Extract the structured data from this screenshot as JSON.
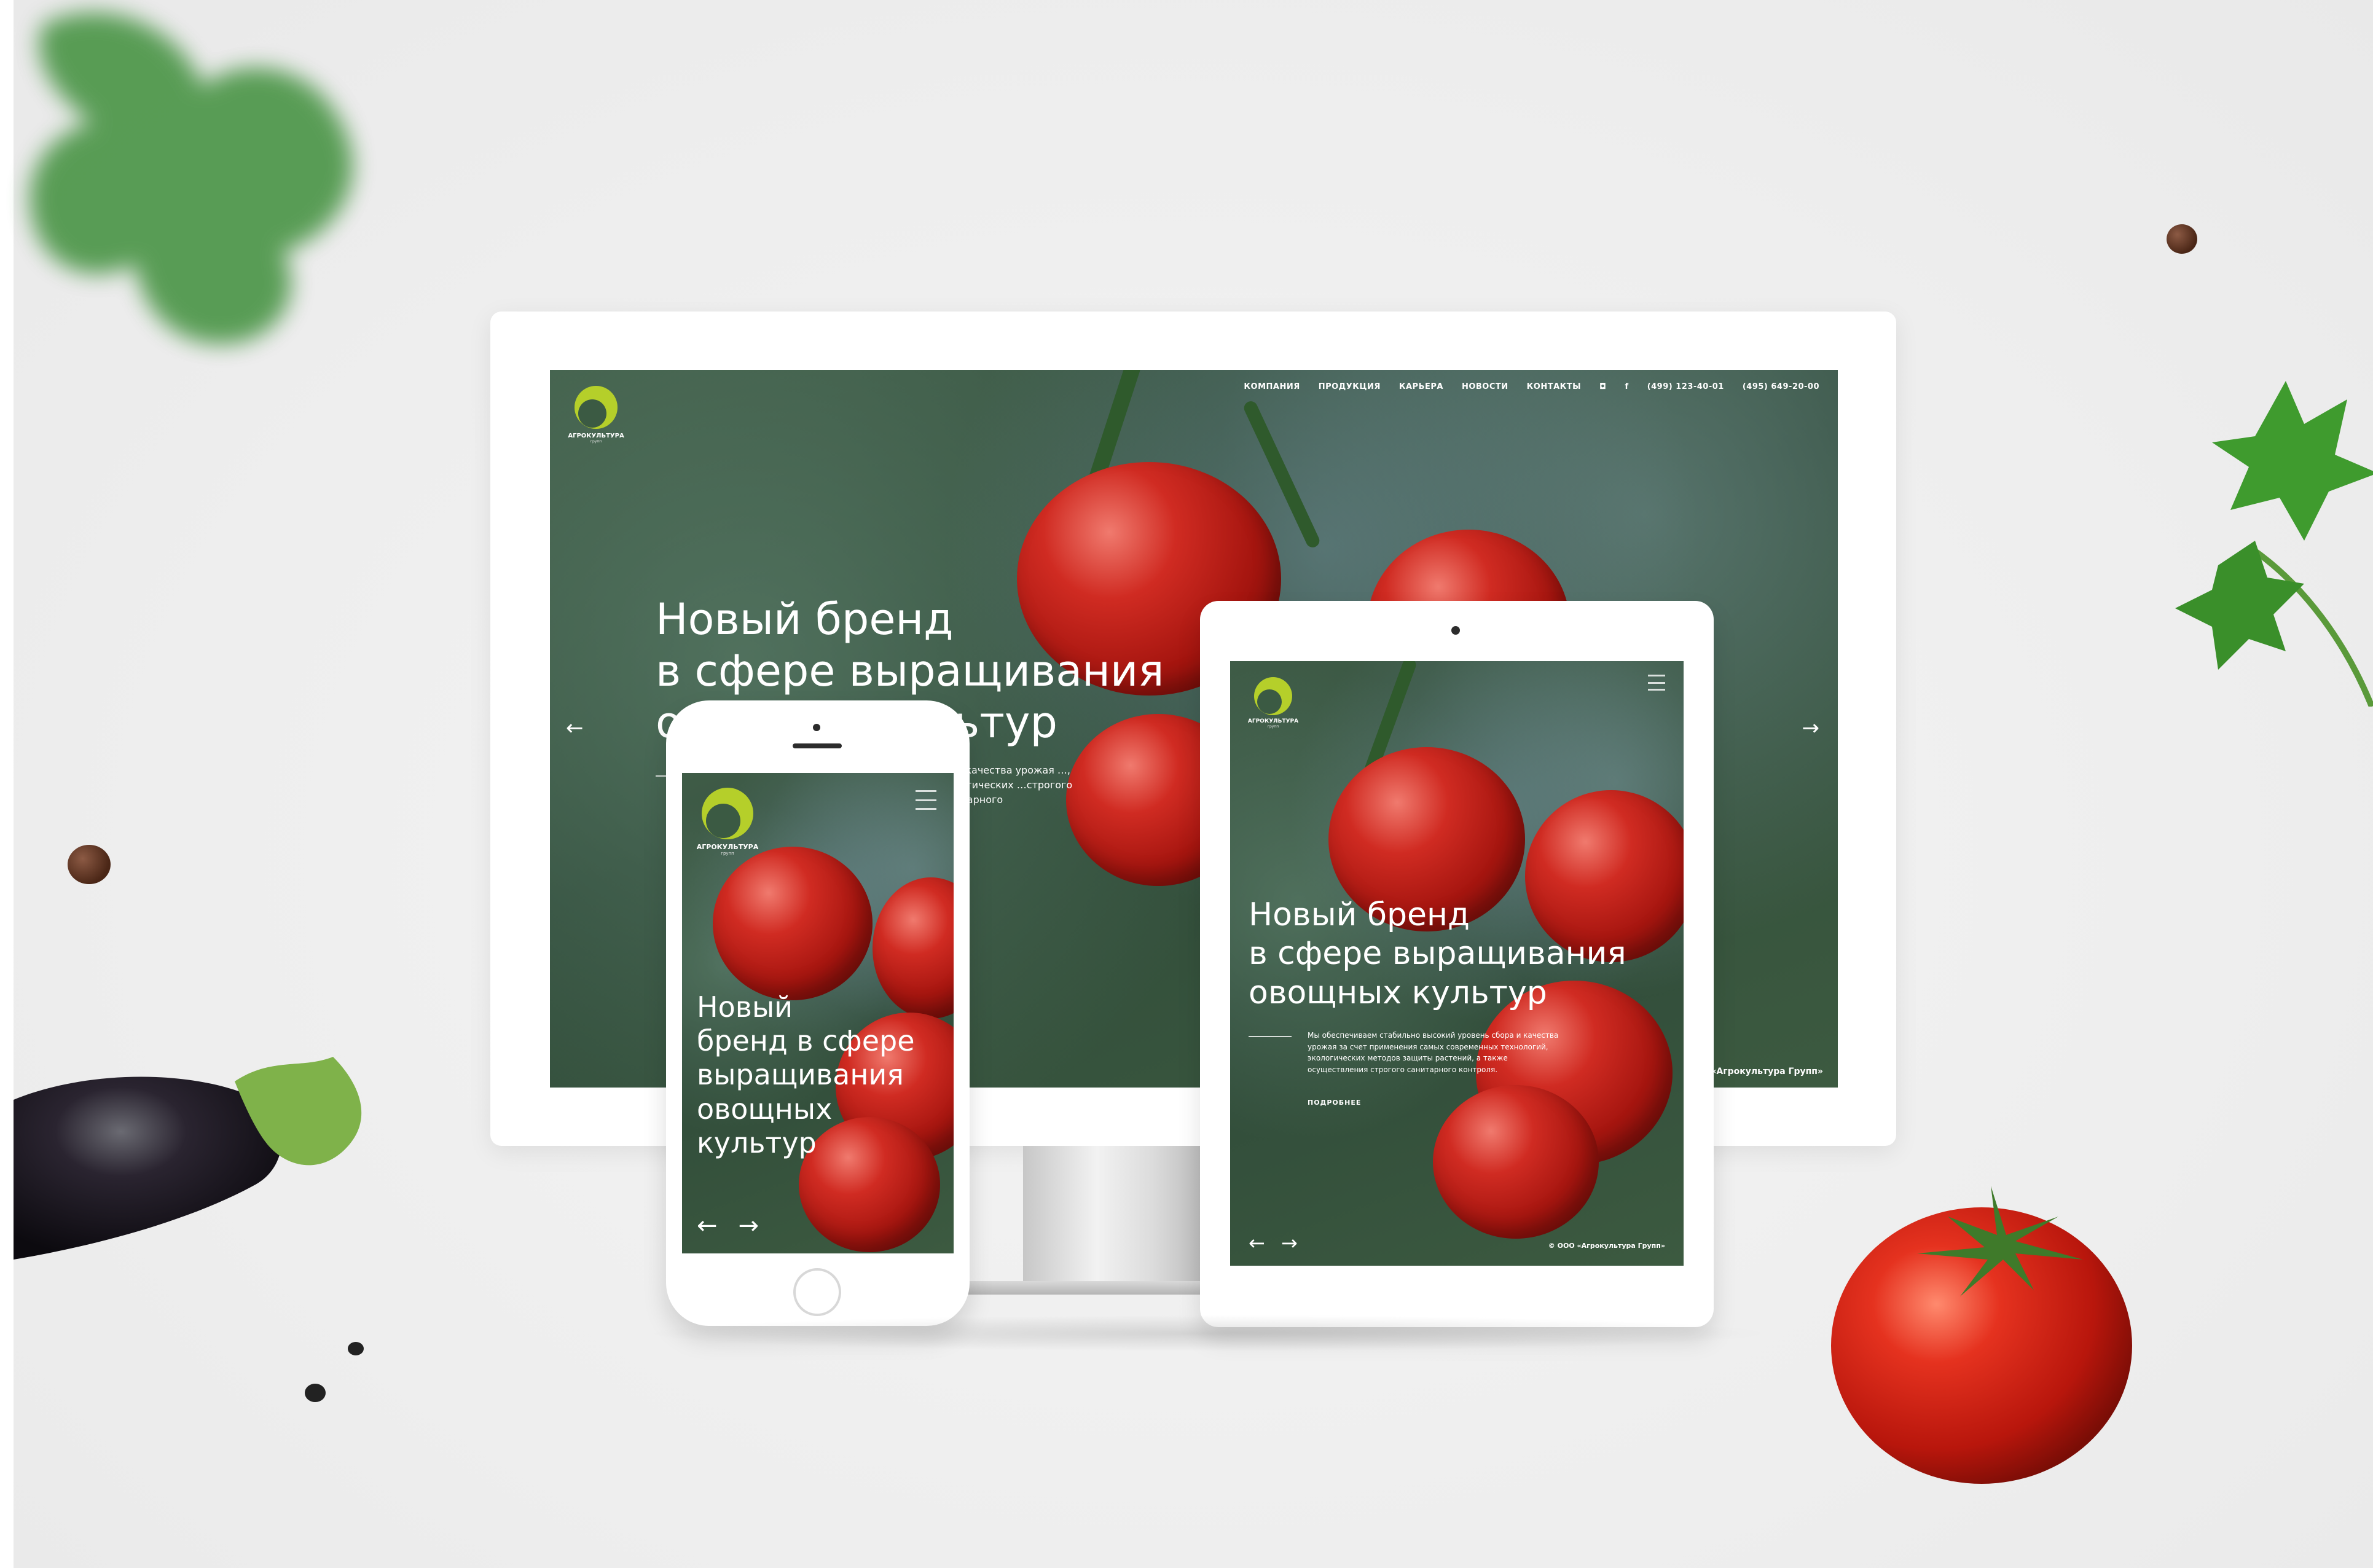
{
  "site": {
    "logo_text": "АГРОКУЛЬТУРА",
    "logo_sub": "групп",
    "nav": [
      "КОМПАНИЯ",
      "ПРОДУКЦИЯ",
      "КАРЬЕРА",
      "НОВОСТИ",
      "КОНТАКТЫ"
    ],
    "social": [
      "instagram-icon",
      "facebook-icon"
    ],
    "phones": [
      "(499) 123-40-01",
      "(495) 649-20-00"
    ],
    "hero_title_lines": [
      "Новый бренд",
      "в сфере выращивания",
      "овощных культур"
    ],
    "phone_title_lines": [
      "Новый",
      "бренд в сфере",
      "выращивания",
      "овощных",
      "культур"
    ],
    "lead_desktop": "…а и качества урожая …, экологических …строгого санитарного",
    "lead_tablet": "Мы обеспечиваем стабильно высокий уровень сбора и качества урожая за счет применения самых современных технологий, экологических методов защиты растений, а также осуществления строгого санитарного контроля.",
    "more_label": "ПОДРОБНЕЕ",
    "copyright": "© ООО «Агрокультура Групп»",
    "arrow_left": "←",
    "arrow_right": "→",
    "facebook_glyph": "f",
    "instagram_glyph": "◘"
  },
  "colors": {
    "accent": "#b5cf2a",
    "background": "#efefef",
    "device": "#ffffff",
    "tomato": "#d02b22",
    "foliage": "#3f5c47"
  }
}
